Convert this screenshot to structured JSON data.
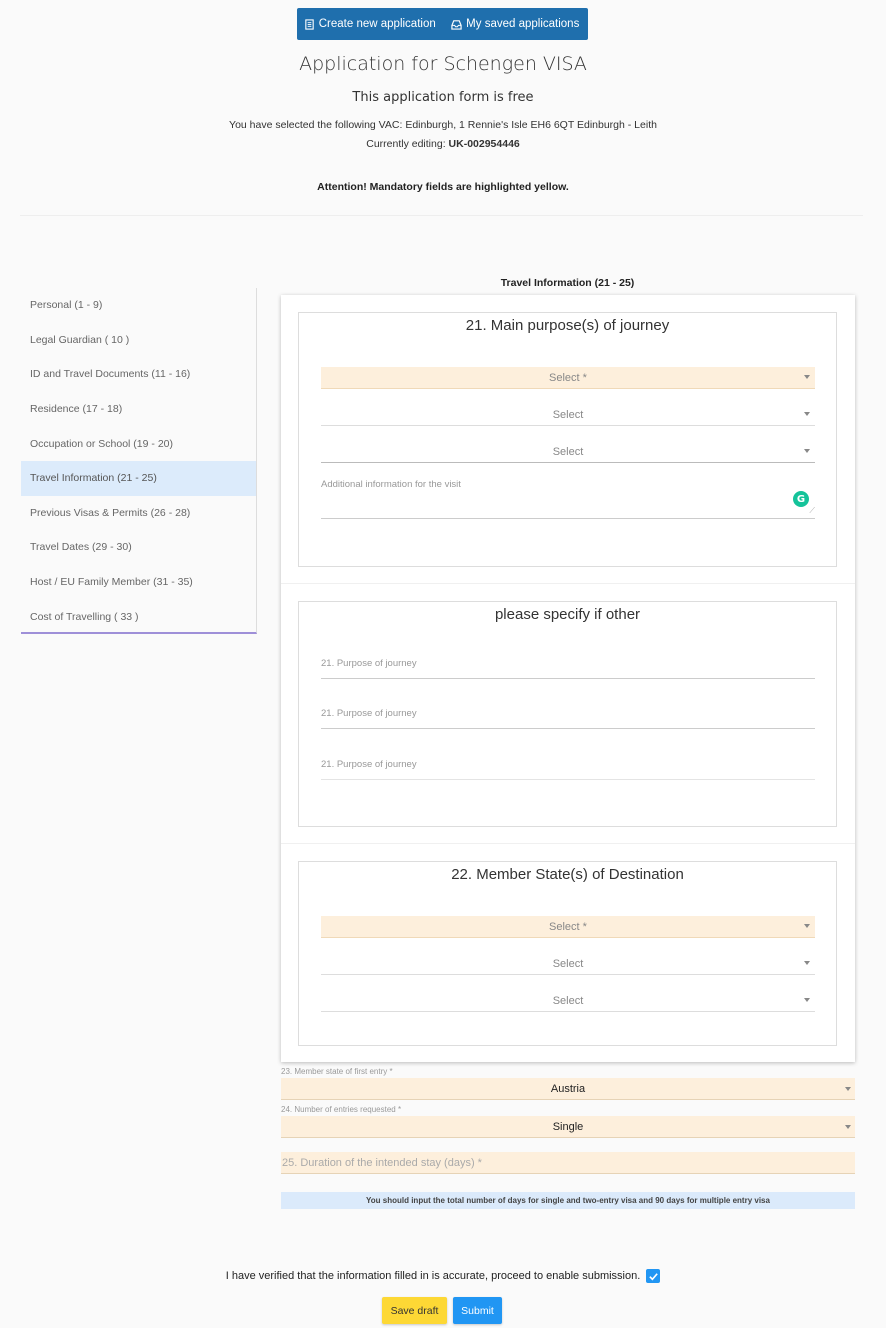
{
  "topbar": {
    "create_label": "Create new application",
    "saved_label": "My saved applications"
  },
  "header": {
    "title": "Application for Schengen VISA",
    "subtitle": "This application form is free",
    "vac_text": "You have selected the following VAC: Edinburgh, 1 Rennie's Isle EH6 6QT Edinburgh - Leith",
    "editing_label": "Currently editing:",
    "editing_id": "UK-002954446",
    "attention": "Attention! Mandatory fields are highlighted yellow."
  },
  "sidebar": {
    "items": [
      {
        "label": "Personal (1 - 9)"
      },
      {
        "label": "Legal Guardian ( 10 )"
      },
      {
        "label": "ID and Travel Documents (11 - 16)"
      },
      {
        "label": "Residence (17 - 18)"
      },
      {
        "label": "Occupation or School (19 - 20)"
      },
      {
        "label": "Travel Information (21 - 25)"
      },
      {
        "label": "Previous Visas & Permits (26 - 28)"
      },
      {
        "label": "Travel Dates (29 - 30)"
      },
      {
        "label": "Host / EU Family Member (31 - 35)"
      },
      {
        "label": "Cost of Travelling ( 33 )"
      }
    ],
    "active_index": 5
  },
  "section": {
    "title": "Travel Information (21 - 25)"
  },
  "purpose": {
    "heading": "21. Main purpose(s) of journey",
    "select_required": "Select *",
    "select_1": "Select",
    "select_2": "Select",
    "additional_placeholder": "Additional information for the visit",
    "grammarly_icon": "G"
  },
  "other": {
    "heading": "please specify if other",
    "field_1": "21. Purpose of journey",
    "field_2": "21. Purpose of journey",
    "field_3": "21. Purpose of journey"
  },
  "destination": {
    "heading": "22. Member State(s) of Destination",
    "select_required": "Select *",
    "select_1": "Select",
    "select_2": "Select"
  },
  "first_entry": {
    "label": "23. Member state of first entry *",
    "value": "Austria"
  },
  "entries": {
    "label": "24. Number of entries requested *",
    "value": "Single"
  },
  "duration": {
    "placeholder": "25. Duration of the intended stay (days) *"
  },
  "info_text": "You should input the total number of days for single and two-entry visa and 90 days for multiple entry visa",
  "verify": {
    "text": "I have verified that the information filled in is accurate, proceed to enable submission.",
    "checked": true
  },
  "buttons": {
    "save_draft": "Save draft",
    "submit": "Submit"
  },
  "colors": {
    "primary": "#1f6fad",
    "required_bg": "#fdefdc",
    "active_nav": "#dcebfb",
    "draft": "#fdd835",
    "submit": "#2196f3"
  }
}
